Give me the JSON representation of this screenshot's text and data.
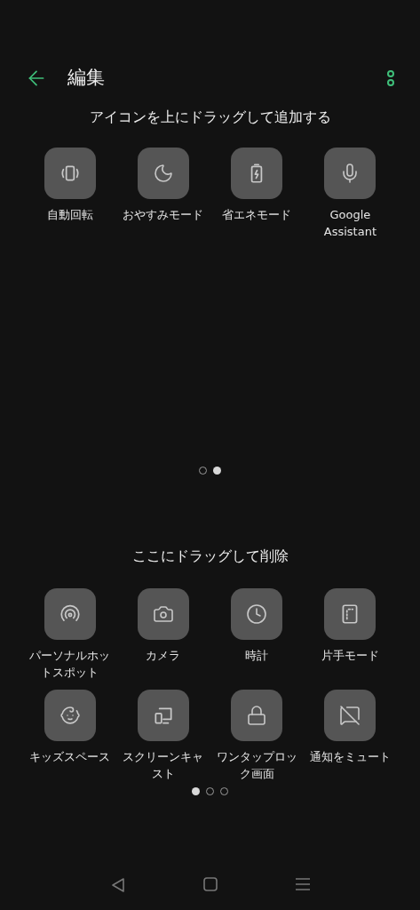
{
  "header": {
    "title": "編集"
  },
  "add_section": {
    "hint": "アイコンを上にドラッグして追加する",
    "tiles": [
      {
        "label": "自動回転"
      },
      {
        "label": "おやすみモード"
      },
      {
        "label": "省エネモード"
      },
      {
        "label": "Google Assistant"
      }
    ],
    "pages": [
      {
        "selected": false
      },
      {
        "selected": true
      }
    ]
  },
  "remove_section": {
    "hint": "ここにドラッグして削除",
    "tiles": [
      {
        "label": "パーソナルホットスポット"
      },
      {
        "label": "カメラ"
      },
      {
        "label": "時計"
      },
      {
        "label": "片手モード"
      },
      {
        "label": "キッズスペース"
      },
      {
        "label": "スクリーンキャスト"
      },
      {
        "label": "ワンタップロック画面"
      },
      {
        "label": "通知をミュート"
      }
    ],
    "pages": [
      {
        "selected": true
      },
      {
        "selected": false
      },
      {
        "selected": false
      }
    ]
  }
}
